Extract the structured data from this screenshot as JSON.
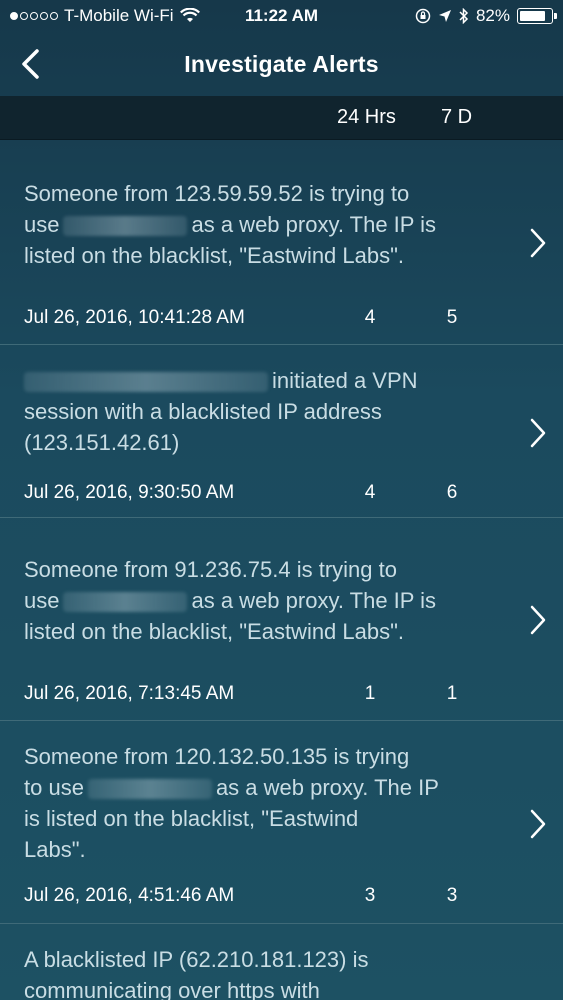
{
  "status_bar": {
    "carrier": "T-Mobile Wi-Fi",
    "time": "11:22 AM",
    "battery": "82%",
    "battery_level": 0.82
  },
  "nav": {
    "title": "Investigate Alerts"
  },
  "filters": {
    "col_24h": "24 Hrs",
    "col_7d": "7 D"
  },
  "alerts": [
    {
      "line1": "Someone from 123.59.59.52 is trying to",
      "line2_pre": "use",
      "line2_post": "as a web proxy. The IP is",
      "line3": "listed on the blacklist, \"Eastwind Labs\".",
      "timestamp": "Jul 26, 2016, 10:41:28 AM",
      "count_24h": "4",
      "count_7d": "5"
    },
    {
      "line1_post": "initiated a VPN",
      "line2": "session with a blacklisted IP address",
      "line3": "(123.151.42.61)",
      "timestamp": "Jul 26, 2016, 9:30:50 AM",
      "count_24h": "4",
      "count_7d": "6"
    },
    {
      "line1": "Someone from 91.236.75.4 is trying to",
      "line2_pre": "use",
      "line2_post": "as a web proxy. The IP is",
      "line3": "listed on the blacklist, \"Eastwind Labs\".",
      "timestamp": "Jul 26, 2016, 7:13:45 AM",
      "count_24h": "1",
      "count_7d": "1"
    },
    {
      "line1": "Someone from 120.132.50.135 is trying",
      "line2_pre": "to use",
      "line2_post": "as a web proxy. The IP",
      "line3": "is listed on the blacklist, \"Eastwind",
      "line4": "Labs\".",
      "timestamp": "Jul 26, 2016, 4:51:46 AM",
      "count_24h": "3",
      "count_7d": "3"
    },
    {
      "line1": "A blacklisted IP (62.210.181.123) is",
      "line2": "communicating over https with"
    }
  ]
}
